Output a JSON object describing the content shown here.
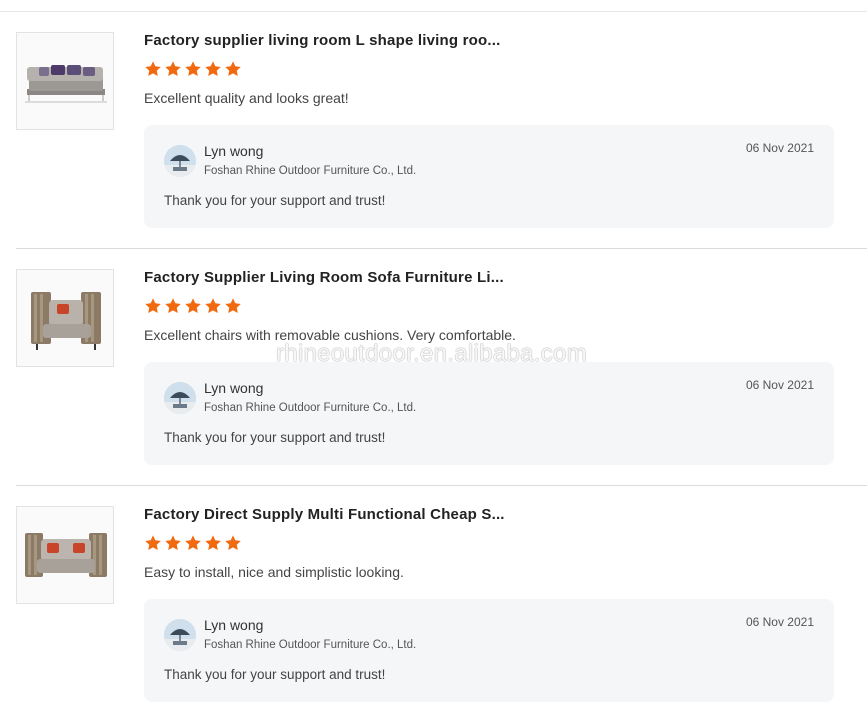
{
  "colors": {
    "star": "#f26a10",
    "reply_bg": "#f5f6f8",
    "divider": "#dcdcdc"
  },
  "reviews": [
    {
      "image_icon": "sofa-product-image",
      "title": "Factory supplier living room L shape living roo...",
      "rating": 5,
      "comment": "Excellent quality and looks great!",
      "reply": {
        "name": "Lyn wong",
        "company": "Foshan Rhine Outdoor Furniture Co., Ltd.",
        "date": "06 Nov 2021",
        "text": "Thank you for your support and trust!"
      }
    },
    {
      "image_icon": "armchair-product-image",
      "title": "Factory Supplier Living Room Sofa Furniture Li...",
      "rating": 5,
      "comment": "Excellent chairs with removable cushions. Very comfortable.",
      "reply": {
        "name": "Lyn wong",
        "company": "Foshan Rhine Outdoor Furniture Co., Ltd.",
        "date": "06 Nov 2021",
        "text": "Thank you for your support and trust!"
      }
    },
    {
      "image_icon": "loveseat-product-image",
      "title": "Factory Direct Supply Multi Functional Cheap S...",
      "rating": 5,
      "comment": "Easy to install, nice and simplistic looking.",
      "reply": {
        "name": "Lyn wong",
        "company": "Foshan Rhine Outdoor Furniture Co., Ltd.",
        "date": "06 Nov 2021",
        "text": "Thank you for your support and trust!"
      }
    }
  ],
  "watermark": "rhineoutdoor.en.alibaba.com"
}
